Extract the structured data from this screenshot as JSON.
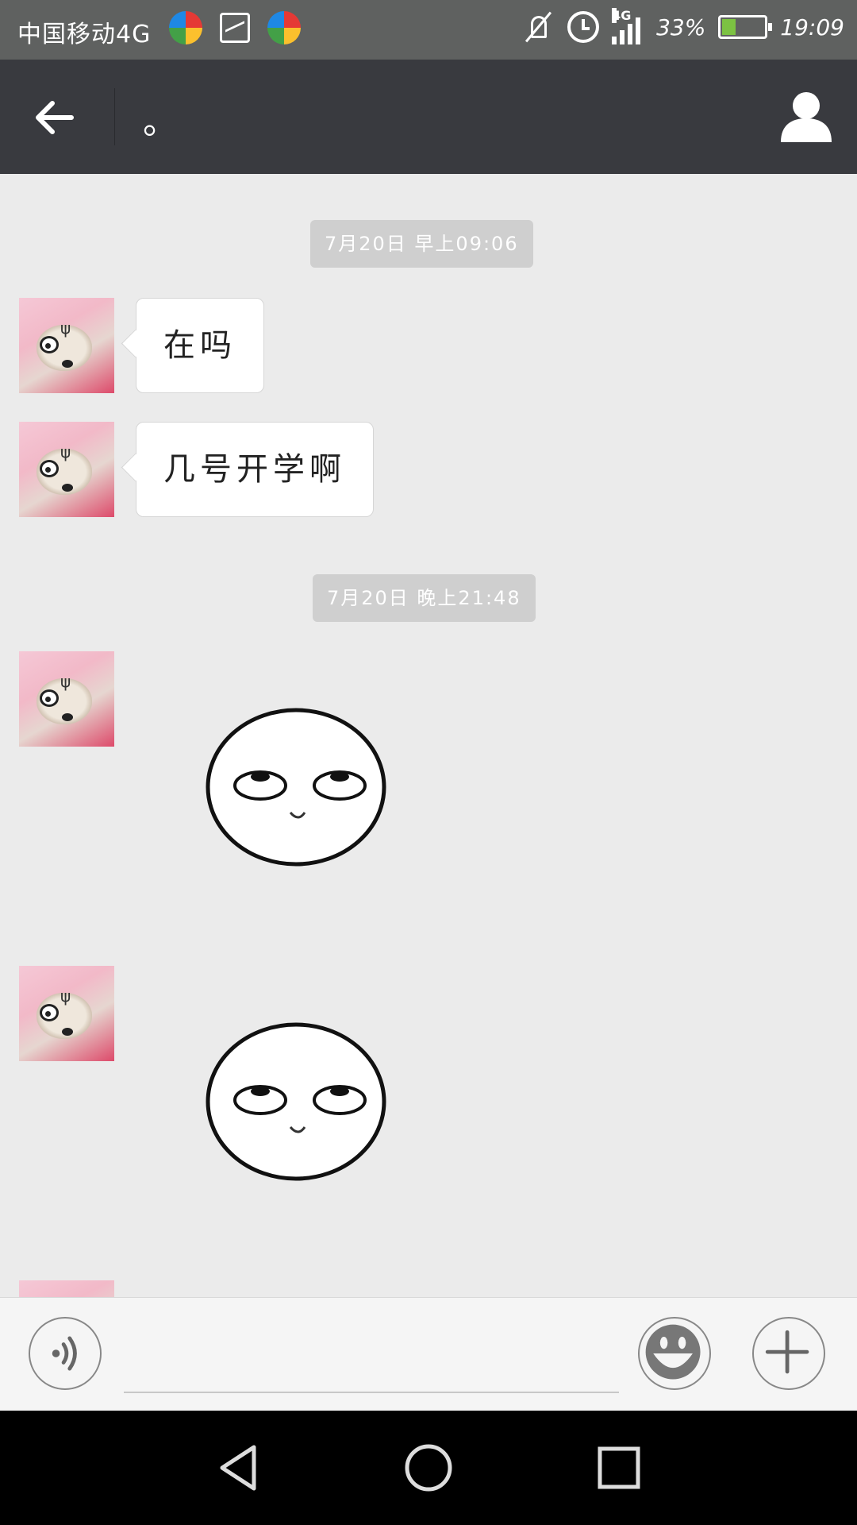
{
  "status_bar": {
    "carrier": "中国移动4G",
    "battery_percent": "33%",
    "battery_level": 0.33,
    "time": "19:09",
    "network_tag": "4G",
    "icons": [
      "app-icon",
      "image-icon",
      "app-icon",
      "mute-icon",
      "alarm-icon",
      "signal-icon",
      "battery-icon"
    ]
  },
  "header": {
    "title": "。",
    "back_icon": "arrow-left-icon",
    "profile_icon": "person-icon"
  },
  "messages": [
    {
      "type": "time",
      "text": "7月20日 早上09:06"
    },
    {
      "type": "text",
      "from": "contact",
      "text": "在吗"
    },
    {
      "type": "text",
      "from": "contact",
      "text": "几号开学啊"
    },
    {
      "type": "time",
      "text": "7月20日 晚上21:48"
    },
    {
      "type": "sticker",
      "from": "contact",
      "sticker": "eye-roll-face"
    },
    {
      "type": "sticker",
      "from": "contact",
      "sticker": "eye-roll-face"
    }
  ],
  "input_bar": {
    "voice_icon": "voice-icon",
    "emoji_icon": "emoji-icon",
    "plus_icon": "plus-icon",
    "input_value": ""
  },
  "nav_bar": {
    "icons": [
      "back-triangle-icon",
      "home-circle-icon",
      "recents-square-icon"
    ]
  },
  "colors": {
    "header_bg": "#393a3f",
    "chat_bg": "#ebebeb",
    "status_bg": "#5f6160",
    "battery_fill": "#7cc242"
  }
}
